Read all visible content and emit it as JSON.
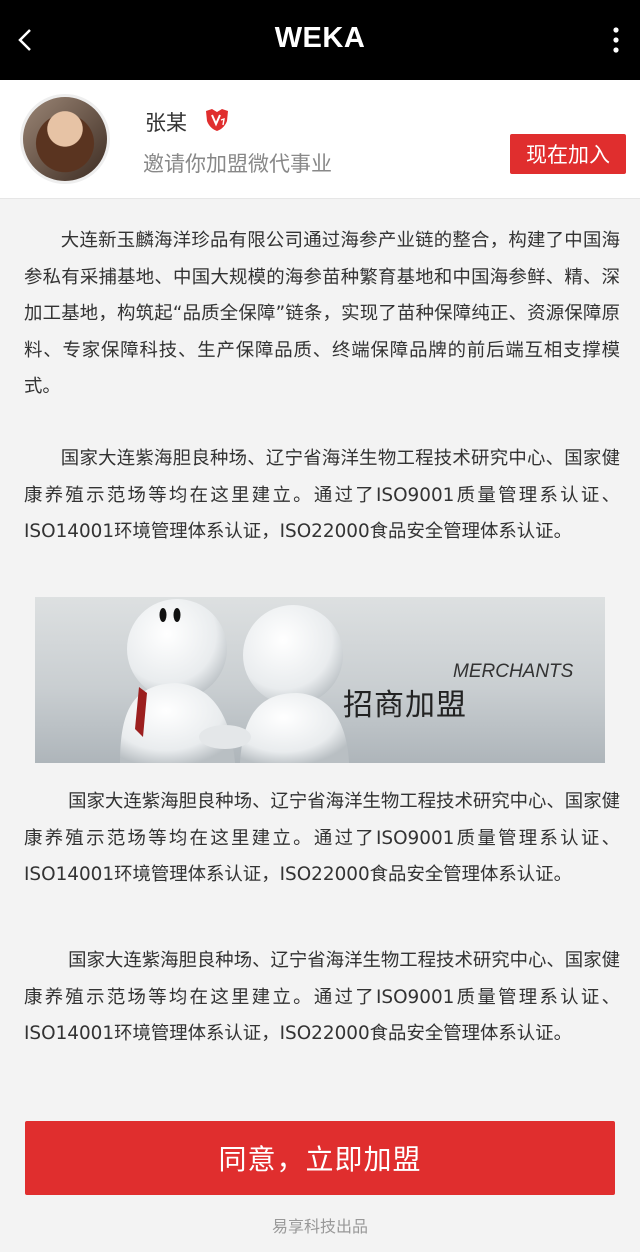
{
  "header": {
    "title": "WEKA",
    "back_icon": "chevron-left-icon",
    "menu_icon": "more-vertical-icon"
  },
  "profile": {
    "name": "张某",
    "badge_icon": "v-shield-icon",
    "subtitle": "邀请你加盟微代事业",
    "join_label": "现在加入"
  },
  "content": {
    "p1": "大连新玉麟海洋珍品有限公司通过海参产业链的整合，构建了中国海参私有采捕基地、中国大规模的海参苗种繁育基地和中国海参鲜、精、深加工基地，构筑起“品质全保障”链条，实现了苗种保障纯正、资源保障原料、专家保障科技、生产保障品质、终端保障品牌的前后端互相支撑模式。",
    "p2": "国家大连紫海胆良种场、辽宁省海洋生物工程技术研究中心、国家健康养殖示范场等均在这里建立。通过了ISO9001质量管理系认证、ISO14001环境管理体系认证，ISO22000食品安全管理体系认证。",
    "banner": {
      "title": "招商加盟",
      "subtitle": "MERCHANTS"
    },
    "p3": "国家大连紫海胆良种场、辽宁省海洋生物工程技术研究中心、国家健康养殖示范场等均在这里建立。通过了ISO9001质量管理系认证、ISO14001环境管理体系认证，ISO22000食品安全管理体系认证。",
    "p4": "国家大连紫海胆良种场、辽宁省海洋生物工程技术研究中心、国家健康养殖示范场等均在这里建立。通过了ISO9001质量管理系认证、ISO14001环境管理体系认证，ISO22000食品安全管理体系认证。"
  },
  "actions": {
    "agree_label": "同意，立即加盟"
  },
  "footer": {
    "text": "易享科技出品"
  },
  "colors": {
    "accent": "#e02e2e",
    "header_bg": "#000000",
    "page_bg": "#f3f3f3"
  }
}
